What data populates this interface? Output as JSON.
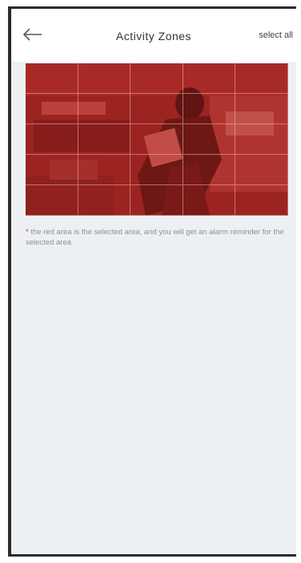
{
  "header": {
    "title": "Activity Zones",
    "select_all_label": "select all"
  },
  "zone_grid": {
    "rows": 5,
    "columns": 5,
    "selected_color": "#c8281f",
    "all_selected": true
  },
  "hint": {
    "marker": "*",
    "text": " the red area is the selected area, and you will get an alarm reminder for the selected area"
  }
}
